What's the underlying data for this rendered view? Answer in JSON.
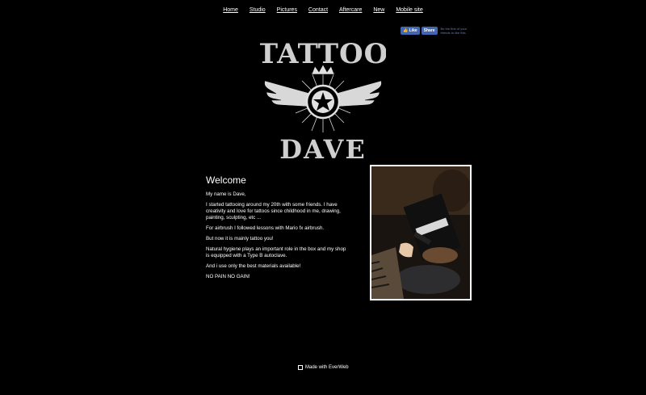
{
  "nav": {
    "items": [
      "Home",
      "Studio",
      "Pictures",
      "Contact",
      "Aftercare",
      "New",
      "Mobile site"
    ]
  },
  "facebook": {
    "like_label": "Like",
    "share_label": "Share",
    "social_text": "Be the first of your friends to like this."
  },
  "logo": {
    "line1": "TATTOO",
    "line2": "DAVE"
  },
  "content": {
    "title": "Welcome",
    "paragraphs": [
      "My name is Dave,",
      "I started tattooing around my 20th with some friends. I have creativity and love for tattoos since childhood in me, drawing, painting, sculpting, etc ...",
      "For airbrush I followed lessons with Mario fx airbrush.",
      "But now it is mainly tattoo you!",
      "Natural hygiene plays an important role in the box and my shop is equipped with a Type B autoclave.",
      "And i use only the best materials available!",
      "NO PAIN NO GAIN!"
    ]
  },
  "footer": {
    "text": "Made with EverWeb",
    "icon": "everweb-icon"
  },
  "colors": {
    "background": "#000000",
    "text": "#ffffff",
    "facebook_blue": "#4267b2"
  }
}
